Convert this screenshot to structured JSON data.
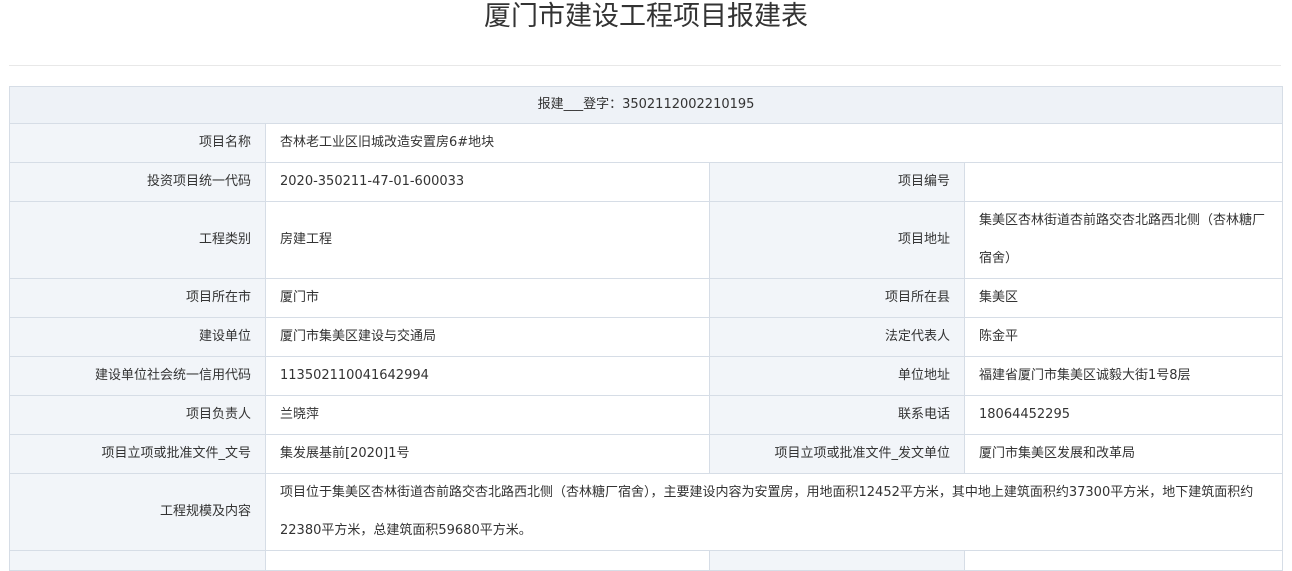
{
  "page_title": "厦门市建设工程项目报建表",
  "header_row": "报建___登字：3502112002210195",
  "rows": {
    "project_name": {
      "label": "项目名称",
      "value": "杏林老工业区旧城改造安置房6#地块"
    },
    "investment_code": {
      "label": "投资项目统一代码",
      "value": "2020-350211-47-01-600033"
    },
    "project_number": {
      "label": "项目编号",
      "value": ""
    },
    "engineering_type": {
      "label": "工程类别",
      "value": "房建工程"
    },
    "project_address": {
      "label": "项目地址",
      "value": "集美区杏林街道杏前路交杏北路西北侧（杏林糖厂宿舍）"
    },
    "city": {
      "label": "项目所在市",
      "value": "厦门市"
    },
    "county": {
      "label": "项目所在县",
      "value": "集美区"
    },
    "builder": {
      "label": "建设单位",
      "value": "厦门市集美区建设与交通局"
    },
    "legal_rep": {
      "label": "法定代表人",
      "value": "陈金平"
    },
    "credit_code": {
      "label": "建设单位社会统一信用代码",
      "value": "113502110041642994"
    },
    "unit_address": {
      "label": "单位地址",
      "value": "福建省厦门市集美区诚毅大街1号8层"
    },
    "project_leader": {
      "label": "项目负责人",
      "value": "兰晓萍"
    },
    "phone": {
      "label": "联系电话",
      "value": "18064452295"
    },
    "approval_doc_no": {
      "label": "项目立项或批准文件_文号",
      "value": "集发展基前[2020]1号"
    },
    "approval_issuer": {
      "label": "项目立项或批准文件_发文单位",
      "value": "厦门市集美区发展和改革局"
    },
    "scale_content": {
      "label": "工程规模及内容",
      "value": "项目位于集美区杏林街道杏前路交杏北路西北侧（杏林糖厂宿舍），主要建设内容为安置房，用地面积12452平方米，其中地上建筑面积约37300平方米，地下建筑面积约22380平方米，总建筑面积59680平方米。"
    }
  }
}
